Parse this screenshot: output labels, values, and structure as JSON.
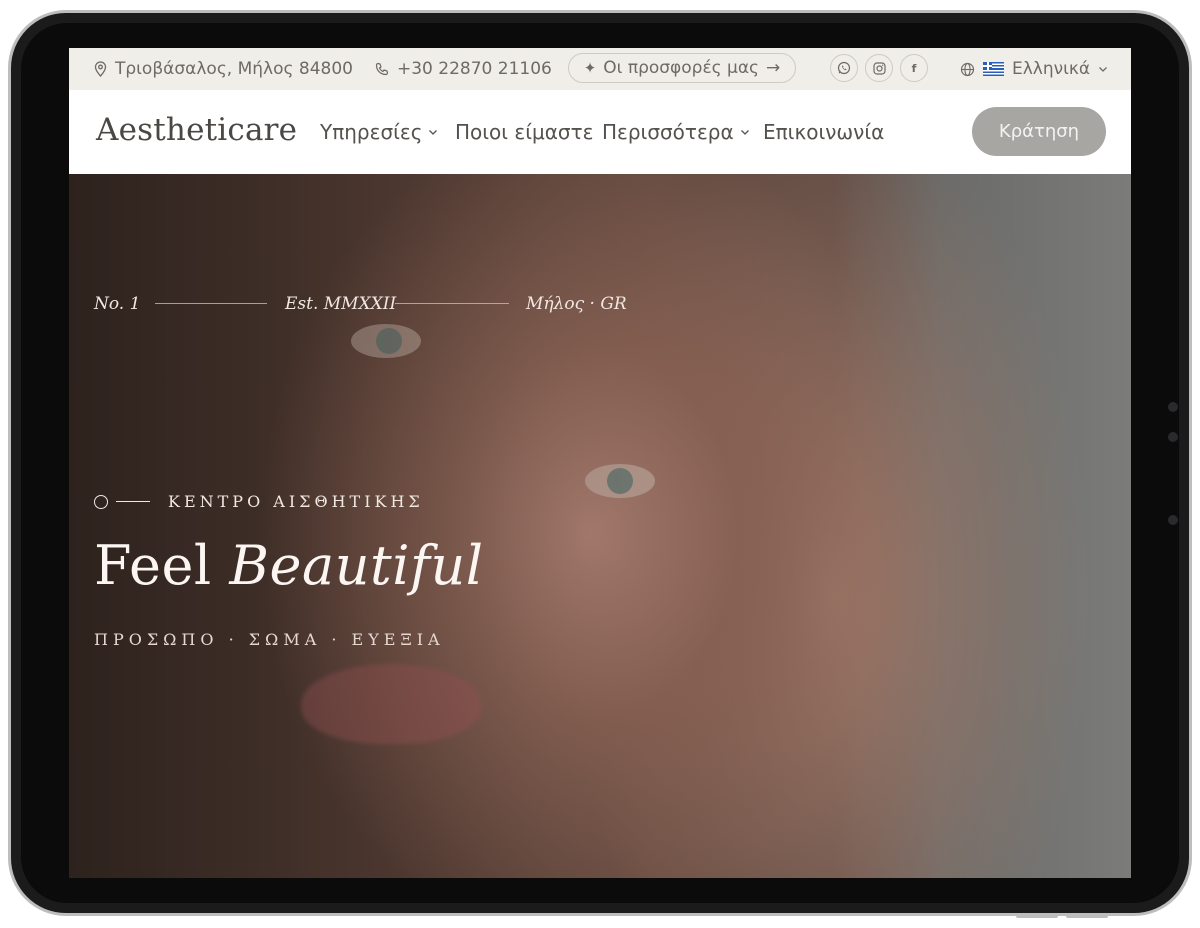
{
  "topbar": {
    "address": "Τριοβάσαλος, Μήλος 84800",
    "phone": "+30 22870 21106",
    "offers_label": "Οι προσφορές μας",
    "offers_arrow": "→",
    "social": [
      "whatsapp-icon",
      "instagram-icon",
      "facebook-icon"
    ],
    "facebook_glyph": "f",
    "language": "Ελληνικά"
  },
  "nav": {
    "logo": "Aestheticare",
    "items": [
      {
        "label": "Υπηρεσίες",
        "has_dropdown": true
      },
      {
        "label": "Ποιοι είμαστε",
        "has_dropdown": false
      },
      {
        "label": "Περισσότερα",
        "has_dropdown": true
      },
      {
        "label": "Επικοινωνία",
        "has_dropdown": false
      }
    ],
    "book_button": "Κράτηση"
  },
  "hero": {
    "meta": [
      "No. 1",
      "Est. MMXXII",
      "Μήλος · GR"
    ],
    "eyebrow": "ΚΕΝΤΡΟ ΑΙΣΘΗΤΙΚΗΣ",
    "headline_plain": "Feel",
    "headline_italic": "Beautiful",
    "subline": "ΠΡΟΣΩΠΟ · ΣΩΜΑ · ΕΥΕΞΙΑ"
  },
  "colors": {
    "topbar_bg": "#efeee9",
    "text_muted": "#6f6a64",
    "button_bg": "#a8a6a3",
    "hero_text": "#fbf6f2"
  }
}
